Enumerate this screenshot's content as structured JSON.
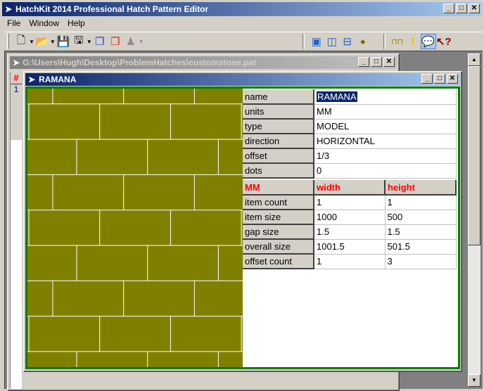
{
  "app": {
    "title": "HatchKit 2014 Professional Hatch Pattern Editor"
  },
  "menu": [
    "File",
    "Window",
    "Help"
  ],
  "toolbar": {
    "icons": [
      "new-file-icon",
      "open-folder-icon",
      "save-icon",
      "save-as-icon",
      "copy-windows-icon",
      "red-windows-icon",
      "stamp-icon",
      "cascade-icon",
      "tile-vertical-icon",
      "tile-horizontal-icon",
      "arrange-icon",
      "ruler-icon",
      "warning-icon",
      "comment-icon",
      "help-icon"
    ]
  },
  "file_window": {
    "title": "G:\\Users\\Hugh\\Desktop\\ProblemHatches\\customstone.pat",
    "col_header": "#",
    "rows": [
      "1"
    ]
  },
  "pattern_window": {
    "title": "RAMANA"
  },
  "properties": [
    {
      "label": "name",
      "value": "RAMANA"
    },
    {
      "label": "units",
      "value": "MM"
    },
    {
      "label": "type",
      "value": "MODEL"
    },
    {
      "label": "direction",
      "value": "HORIZONTAL"
    },
    {
      "label": "offset",
      "value": "1/3"
    },
    {
      "label": "dots",
      "value": "0"
    }
  ],
  "dimensions": {
    "headers": [
      "MM",
      "width",
      "height"
    ],
    "rows": [
      {
        "label": "item count",
        "width": "1",
        "height": "1"
      },
      {
        "label": "item size",
        "width": "1000",
        "height": "500"
      },
      {
        "label": "gap size",
        "width": "1.5",
        "height": "1.5"
      },
      {
        "label": "overall size",
        "width": "1001.5",
        "height": "501.5"
      },
      {
        "label": "offset count",
        "width": "1",
        "height": "3"
      }
    ]
  },
  "colors": {
    "tile": "#808000",
    "grout": "#ffffff",
    "border": "#008000"
  }
}
